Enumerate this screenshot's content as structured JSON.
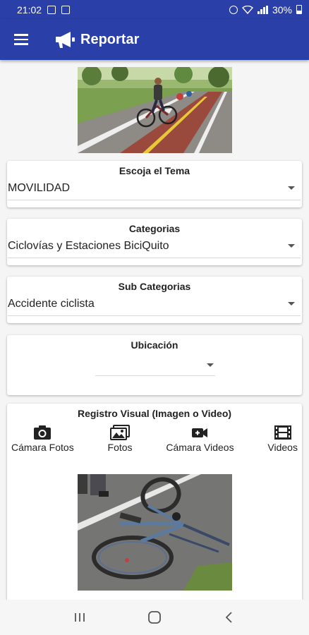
{
  "status_bar": {
    "time": "21:02",
    "battery": "30%"
  },
  "app_bar": {
    "title": "Reportar",
    "menu_icon": "hamburger-menu-icon",
    "logo_icon": "megaphone-icon",
    "color": "#2a3fa8"
  },
  "tema": {
    "title": "Escoja el Tema",
    "selected": "MOVILIDAD"
  },
  "categorias": {
    "title": "Categorias",
    "selected": "Ciclovías y Estaciones BiciQuito"
  },
  "sub_categorias": {
    "title": "Sub Categorias",
    "selected": "Accidente ciclista"
  },
  "ubicacion": {
    "title": "Ubicación",
    "selected": ""
  },
  "registro_visual": {
    "title": "Registro Visual (Imagen o Video)",
    "buttons": [
      {
        "label": "Cámara Fotos",
        "icon": "camera-icon"
      },
      {
        "label": "Fotos",
        "icon": "photo-gallery-icon"
      },
      {
        "label": "Cámara Videos",
        "icon": "video-camera-icon"
      },
      {
        "label": "Videos",
        "icon": "film-icon"
      }
    ]
  },
  "nav_bar": {
    "recent_icon": "recent-apps-icon",
    "home_icon": "home-icon",
    "back_icon": "back-icon"
  }
}
